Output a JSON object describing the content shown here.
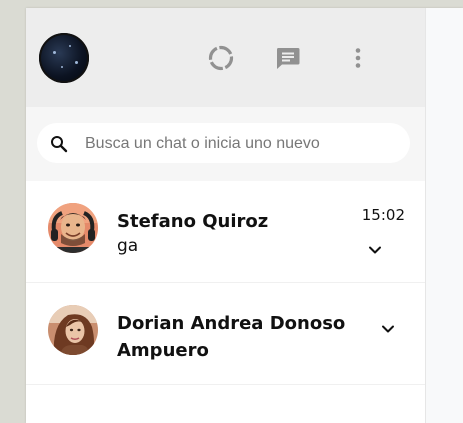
{
  "header": {
    "icons": [
      "status-icon",
      "new-chat-icon",
      "menu-kebab-icon"
    ]
  },
  "search": {
    "placeholder": "Busca un chat o inicia uno nuevo",
    "value": ""
  },
  "chats": [
    {
      "name": "Stefano Quiroz",
      "preview": "ga",
      "time": "15:02"
    },
    {
      "name": "Dorian Andrea Donoso Ampuero",
      "preview": "",
      "time": ""
    }
  ],
  "colors": {
    "header_bg": "#ededed",
    "search_bg": "#f6f6f6",
    "icon_gray": "#919191",
    "page_bg": "#dadbd3"
  }
}
